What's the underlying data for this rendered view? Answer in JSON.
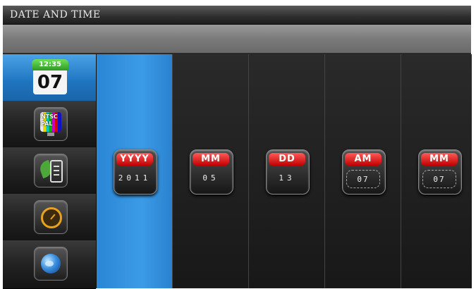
{
  "window": {
    "title": "DATE AND TIME"
  },
  "sidebar": {
    "items": [
      {
        "name": "date-time",
        "icon": "calendar-icon",
        "calendar_time": "12:35",
        "calendar_day": "07",
        "active": true
      },
      {
        "name": "tv-system",
        "icon": "tv-icon",
        "line1": "NTSC",
        "line2": "PAL"
      },
      {
        "name": "eco",
        "icon": "eco-document-icon"
      },
      {
        "name": "gauge",
        "icon": "gauge-icon"
      },
      {
        "name": "globe",
        "icon": "globe-icon"
      }
    ]
  },
  "fields": [
    {
      "label": "YYYY",
      "value": "2011",
      "active": true
    },
    {
      "label": "MM",
      "value": "05"
    },
    {
      "label": "DD",
      "value": "13"
    },
    {
      "label": "AM",
      "value": "07"
    },
    {
      "label": "MM",
      "value": "07"
    }
  ],
  "colors": {
    "accent": "#2a86d6",
    "label_red": "#c00000",
    "calendar_green": "#2e9a22"
  }
}
